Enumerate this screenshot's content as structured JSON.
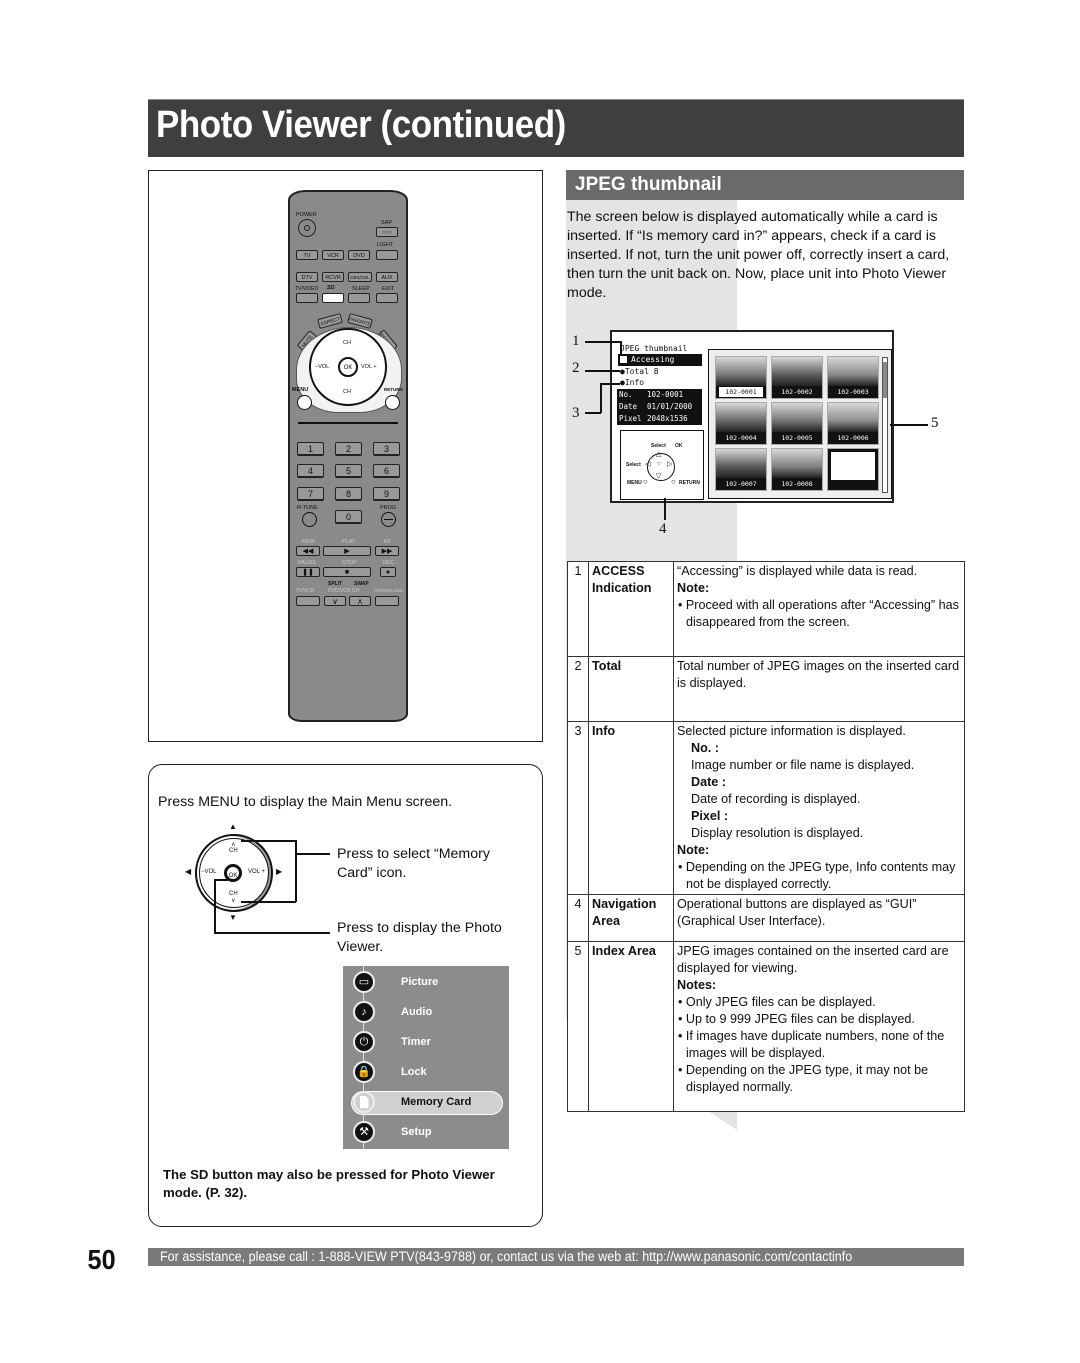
{
  "header": {
    "title": "Photo Viewer (continued)"
  },
  "section": {
    "title": "JPEG thumbnail"
  },
  "intro": "The screen below is displayed automatically while a card is inserted. If “Is memory card in?” appears, check if a card is inserted. If not, turn the unit power off, correctly insert a card, then turn the unit back on. Now, place unit into Photo Viewer mode.",
  "remote": {
    "power": "POWER",
    "sap": "SAP",
    "light": "LIGHT",
    "row1": [
      "TV",
      "VCR",
      "DVD"
    ],
    "row2": [
      "DTV",
      "RCVR",
      "DBS/CBL",
      "AUX"
    ],
    "row3": [
      "TV/VIDEO",
      "SD",
      "SLEEP",
      "EXIT"
    ],
    "arc": [
      "MUTE",
      "ASPECT",
      "FAVORITE",
      "RECALL"
    ],
    "ch": "CH",
    "vol_minus": "−VOL",
    "vol_plus": "VOL +",
    "ok": "OK",
    "menu": "MENU",
    "return": "RETURN",
    "digits": [
      "1",
      "2",
      "3",
      "4",
      "5",
      "6",
      "7",
      "8",
      "9",
      "0"
    ],
    "rtune": "R-TUNE",
    "prog": "PROG",
    "transport1": [
      "REW",
      "PLAY",
      "FF"
    ],
    "transport2": [
      "PAUSE",
      "STOP",
      "REC"
    ],
    "split": "SPLIT",
    "swap": "SWAP",
    "tvvcr": "TV/VCR",
    "dvdvcrch": "DVD/VCR CH",
    "openclose": "OPEN/CLOSE"
  },
  "screen": {
    "title": "JPEG thumbnail",
    "accessing": "Accessing",
    "total": "Total 8",
    "info": "Info",
    "info_rows": [
      {
        "label": "No.",
        "value": "102-0001"
      },
      {
        "label": "Date",
        "value": "01/01/2000"
      },
      {
        "label": "Pixel",
        "value": "2048x1536"
      }
    ],
    "nav": {
      "select_top": "Select",
      "ok": "OK",
      "select_left": "Select",
      "menu": "MENU",
      "return": "RETURN"
    },
    "thumbnails": [
      "102-0001",
      "102-0002",
      "102-0003",
      "102-0004",
      "102-0005",
      "102-0006",
      "102-0007",
      "102-0008"
    ],
    "callouts": [
      "1",
      "2",
      "3",
      "4",
      "5"
    ]
  },
  "legend": [
    {
      "num": "1",
      "key": [
        "ACCESS",
        "Indication"
      ],
      "lines": [
        {
          "t": "“Accessing” is displayed while data is read.",
          "s": "p"
        },
        {
          "t": "Note:",
          "s": "b"
        },
        {
          "t": "• Proceed with all operations after “Accessing” has disappeared from the screen.",
          "s": "bul"
        }
      ]
    },
    {
      "num": "2",
      "key": [
        "Total"
      ],
      "lines": [
        {
          "t": "Total number of JPEG images on the inserted card is displayed.",
          "s": "p"
        }
      ]
    },
    {
      "num": "3",
      "key": [
        "Info"
      ],
      "lines": [
        {
          "t": "Selected picture information is displayed.",
          "s": "p"
        },
        {
          "t": "No. :",
          "s": "ib"
        },
        {
          "t": "Image number or file name is displayed.",
          "s": "i"
        },
        {
          "t": "Date :",
          "s": "ib"
        },
        {
          "t": "Date of recording is displayed.",
          "s": "i"
        },
        {
          "t": "Pixel :",
          "s": "ib"
        },
        {
          "t": "Display resolution is displayed.",
          "s": "i"
        },
        {
          "t": "Note:",
          "s": "b"
        },
        {
          "t": "• Depending on the JPEG type, Info contents may not be displayed correctly.",
          "s": "bul"
        }
      ]
    },
    {
      "num": "4",
      "key": [
        "Navigation",
        "Area"
      ],
      "lines": [
        {
          "t": "Operational buttons are displayed as “GUI” (Graphical User Interface).",
          "s": "p"
        }
      ]
    },
    {
      "num": "5",
      "key": [
        "Index Area"
      ],
      "lines": [
        {
          "t": "JPEG images contained on the inserted card are displayed for viewing.",
          "s": "p"
        },
        {
          "t": "Notes:",
          "s": "b"
        },
        {
          "t": "• Only JPEG files can be displayed.",
          "s": "bul"
        },
        {
          "t": "• Up to 9 999 JPEG files can be displayed.",
          "s": "bul"
        },
        {
          "t": "• If images have duplicate numbers, none of the images will be displayed.",
          "s": "bul"
        },
        {
          "t": "• Depending on the JPEG type, it may not be displayed normally.",
          "s": "bul"
        }
      ]
    }
  ],
  "steps": {
    "step1": "Press MENU to display the Main Menu screen.",
    "dpad": {
      "ch": "CH",
      "vol_minus": "−VOL",
      "vol_plus": "VOL +",
      "ok": "OK"
    },
    "select_text": "Press to select “Memory Card” icon.",
    "display_text": "Press to display the Photo Viewer.",
    "sd_note": "The SD button may also be pressed for Photo Viewer mode. (P. 32)."
  },
  "menu": {
    "items": [
      {
        "label": "Picture",
        "icon": "tv-icon"
      },
      {
        "label": "Audio",
        "icon": "music-note-icon"
      },
      {
        "label": "Timer",
        "icon": "power-icon"
      },
      {
        "label": "Lock",
        "icon": "padlock-icon"
      },
      {
        "label": "Memory Card",
        "icon": "sd-card-icon",
        "selected": true
      },
      {
        "label": "Setup",
        "icon": "wrench-icon"
      }
    ]
  },
  "footer": {
    "page_number": "50",
    "assistance": "For assistance, please call : 1-888-VIEW PTV(843-9788) or, contact us via the web at: http://www.panasonic.com/contactinfo"
  }
}
